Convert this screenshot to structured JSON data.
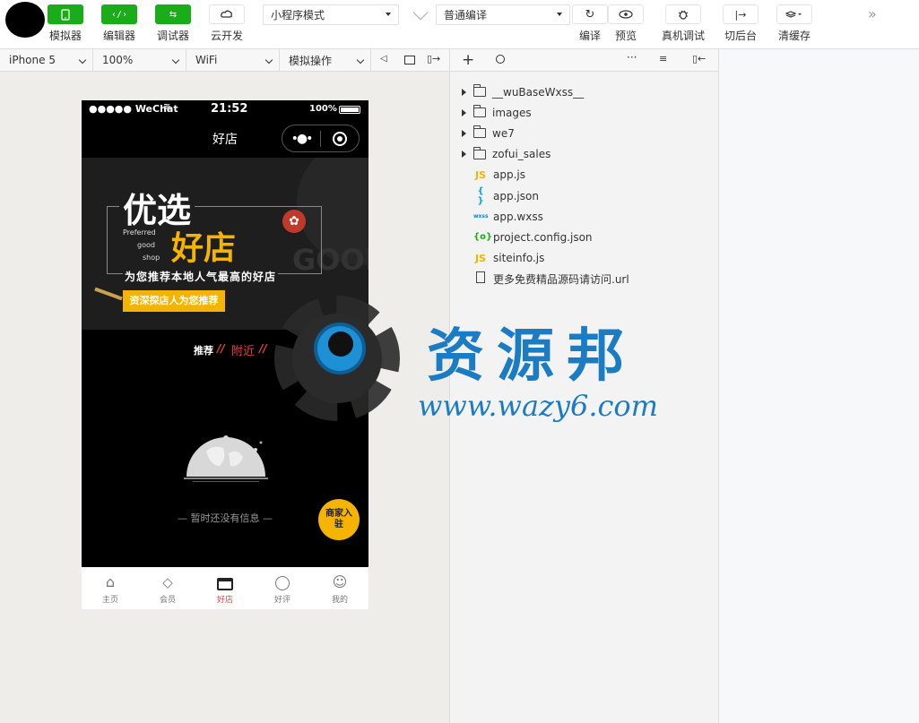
{
  "toolbar": {
    "simulator": "模拟器",
    "editor": "编辑器",
    "debugger": "调试器",
    "cloud": "云开发",
    "mode": "小程序模式",
    "compile_mode": "普通编译",
    "compile": "编译",
    "preview": "预览",
    "remote_debug": "真机调试",
    "background": "切后台",
    "clear_cache": "清缓存"
  },
  "devbar": {
    "device": "iPhone 5",
    "zoom": "100%",
    "network": "WiFi",
    "operation": "模拟操作"
  },
  "phone": {
    "carrier": "●●●●● WeChat",
    "time": "21:52",
    "battery": "100%",
    "title": "好店",
    "banner_big1": "优选",
    "banner_big2": "好店",
    "banner_en1": "Preferred",
    "banner_en2": "good",
    "banner_en3": "shop",
    "banner_slogan": "为您推荐本地人气最高的好店",
    "banner_btn": "资深探店人为您推荐",
    "banner_good": "GOOD",
    "filter_recommend": "推荐",
    "filter_nearby": "附近",
    "empty_text": "— 暂时还没有信息 —",
    "badge": "商家入驻",
    "tabs": [
      {
        "label": "主页"
      },
      {
        "label": "会员"
      },
      {
        "label": "好店"
      },
      {
        "label": "好评"
      },
      {
        "label": "我的"
      }
    ]
  },
  "files": [
    {
      "name": "__wuBaseWxss__",
      "type": "folder"
    },
    {
      "name": "images",
      "type": "folder"
    },
    {
      "name": "we7",
      "type": "folder"
    },
    {
      "name": "zofui_sales",
      "type": "folder"
    },
    {
      "name": "app.js",
      "type": "js"
    },
    {
      "name": "app.json",
      "type": "json"
    },
    {
      "name": "app.wxss",
      "type": "wxss"
    },
    {
      "name": "project.config.json",
      "type": "config"
    },
    {
      "name": "siteinfo.js",
      "type": "js"
    },
    {
      "name": "更多免费精品源码请访问.url",
      "type": "file"
    }
  ],
  "watermark": {
    "cn": "资源邦",
    "url": "www.wazy6.com"
  },
  "colors": {
    "green": "#1aad19",
    "accent": "#e64340",
    "gold": "#f5b400"
  }
}
